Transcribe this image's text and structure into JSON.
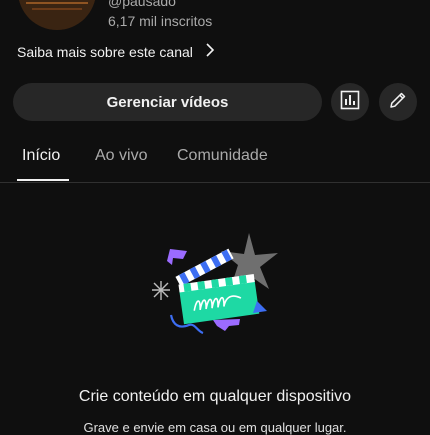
{
  "channel": {
    "handle": "@pausado",
    "subscribers": "6,17 mil inscritos",
    "learn_more": "Saiba mais sobre este canal"
  },
  "actions": {
    "manage_videos": "Gerenciar vídeos",
    "analytics_icon": "bar-chart-icon",
    "edit_icon": "pencil-icon"
  },
  "tabs": [
    {
      "label": "Início",
      "active": true
    },
    {
      "label": "Ao vivo",
      "active": false
    },
    {
      "label": "Comunidade",
      "active": false
    }
  ],
  "empty_state": {
    "illustration_icon": "clapperboard-icon",
    "title": "Crie conteúdo em qualquer dispositivo",
    "subtitle": "Grave e envie em casa ou em qualquer lugar."
  },
  "colors": {
    "background": "#0f0f0f",
    "surface": "#272727",
    "text_primary": "#f1f1f1",
    "text_secondary": "#aaaaaa",
    "accent_teal": "#1ed9a4",
    "accent_blue": "#3d6ef2",
    "accent_purple": "#9b6bff"
  }
}
